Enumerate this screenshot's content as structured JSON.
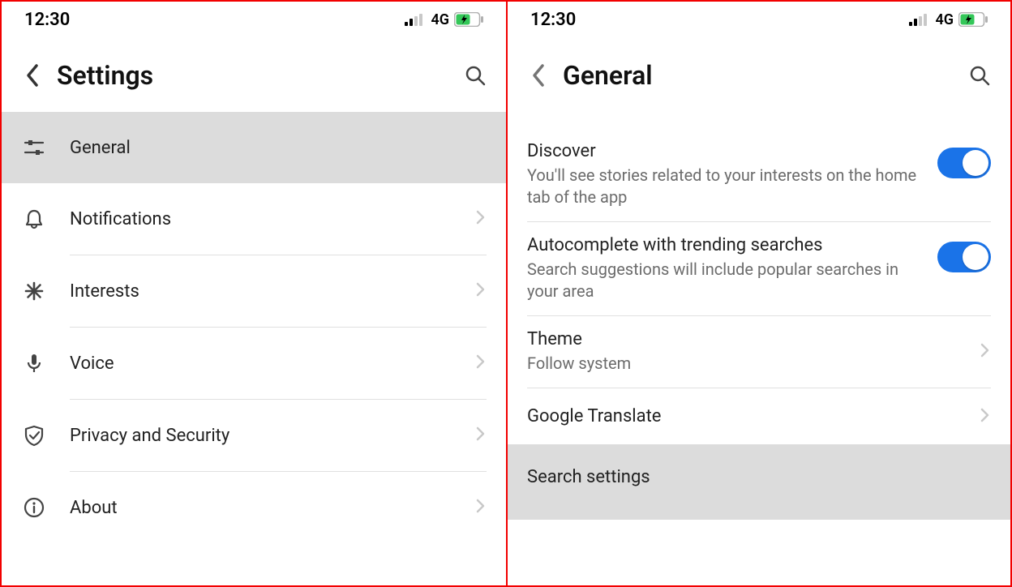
{
  "status": {
    "time": "12:30",
    "network_label": "4G"
  },
  "left": {
    "title": "Settings",
    "items": [
      {
        "label": "General"
      },
      {
        "label": "Notifications"
      },
      {
        "label": "Interests"
      },
      {
        "label": "Voice"
      },
      {
        "label": "Privacy and Security"
      },
      {
        "label": "About"
      }
    ]
  },
  "right": {
    "title": "General",
    "rows": {
      "discover": {
        "title": "Discover",
        "subtitle": "You'll see stories related to your interests on the home tab of the app"
      },
      "autocomplete": {
        "title": "Autocomplete with trending searches",
        "subtitle": "Search suggestions will include popular searches in your area"
      },
      "theme": {
        "title": "Theme",
        "subtitle": "Follow system"
      },
      "translate": {
        "title": "Google Translate"
      },
      "search_settings": {
        "title": "Search settings"
      }
    }
  }
}
